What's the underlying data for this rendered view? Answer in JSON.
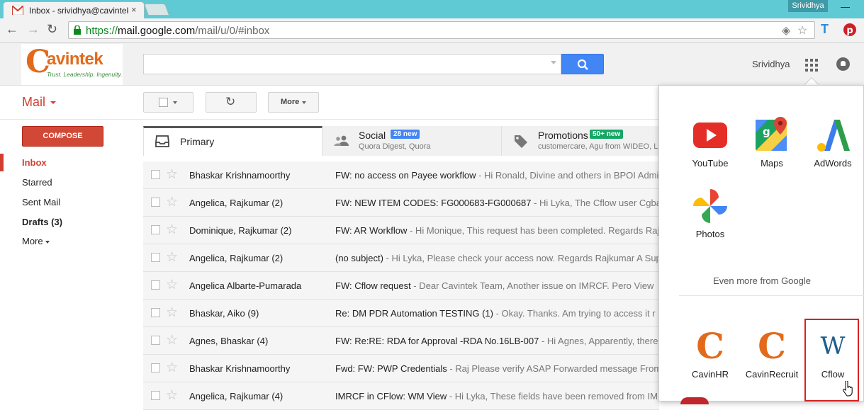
{
  "browser": {
    "tab_title": "Inbox - srividhya@cavintek",
    "tab_close": "×",
    "user_badge": "Srividhya",
    "minimize": "—",
    "url_scheme": "https://",
    "url_host": "mail.google.com",
    "url_path": "/mail/u/0/#inbox"
  },
  "header": {
    "logo_letter": "C",
    "logo_name": "avintek",
    "logo_tagline": "Trust. Leadership. Ingenuity.",
    "search_placeholder": "",
    "user_name": "Srividhya"
  },
  "toolbar": {
    "mail_label": "Mail",
    "more_label": "More"
  },
  "nav": {
    "compose_label": "COMPOSE",
    "items": [
      {
        "label": "Inbox"
      },
      {
        "label": "Starred"
      },
      {
        "label": "Sent Mail"
      },
      {
        "label": "Drafts (3)"
      },
      {
        "label": "More"
      }
    ]
  },
  "tabs": {
    "primary": {
      "label": "Primary"
    },
    "social": {
      "label": "Social",
      "badge": "28 new",
      "sub": "Quora Digest, Quora"
    },
    "promotions": {
      "label": "Promotions",
      "badge": "50+ new",
      "sub": "customercare, Agu from WIDEO, L"
    }
  },
  "emails": [
    {
      "sender": "Bhaskar Krishnamoorthy",
      "subject": "FW: no access on Payee workflow",
      "preview": " - Hi Ronald, Divine and others in BPOI Admi"
    },
    {
      "sender": "Angelica, Rajkumar (2)",
      "subject": "FW: NEW ITEM CODES: FG000683-FG000687",
      "preview": " - Hi Lyka, The Cflow user Cgba"
    },
    {
      "sender": "Dominique, Rajkumar (2)",
      "subject": "FW: AR Workflow",
      "preview": " - Hi Monique, This request has been completed. Regards Raj"
    },
    {
      "sender": "Angelica, Rajkumar (2)",
      "subject": "(no subject)",
      "preview": " - Hi Lyka, Please check your access now. Regards Rajkumar A Supp"
    },
    {
      "sender": "Angelica Albarte-Pumarada",
      "subject": "FW: Cflow request",
      "preview": " - Dear Cavintek Team, Another issue on IMRCF. Pero View"
    },
    {
      "sender": "Bhaskar, Aiko (9)",
      "subject": "Re: DM PDR Automation TESTING (1)",
      "preview": " - Okay. Thanks. Am trying to access it r"
    },
    {
      "sender": "Agnes, Bhaskar (4)",
      "subject": "FW: Re:RE: RDA for Approval -RDA No.16LB-007",
      "preview": " - Hi Agnes, Apparently, there"
    },
    {
      "sender": "Bhaskar Krishnamoorthy",
      "subject": "Fwd: FW: PWP Credentials",
      "preview": " - Raj Please verify ASAP Forwarded message From"
    },
    {
      "sender": "Angelica, Rajkumar (4)",
      "subject": "IMRCF in CFlow: WM View",
      "preview": " - Hi Lyka, These fields have been removed from IM"
    }
  ],
  "apps_panel": {
    "apps": [
      {
        "label": "YouTube",
        "icon": "youtube-icon"
      },
      {
        "label": "Maps",
        "icon": "maps-icon"
      },
      {
        "label": "AdWords",
        "icon": "adwords-icon"
      },
      {
        "label": "Photos",
        "icon": "photos-icon"
      }
    ],
    "even_more": "Even more from Google",
    "custom_apps": [
      {
        "label": "CavinHR",
        "icon": "cavinhr-icon",
        "glyph": "C"
      },
      {
        "label": "CavinRecruit",
        "icon": "cavinrecruit-icon",
        "glyph": "C"
      },
      {
        "label": "Cflow",
        "icon": "cflow-icon",
        "glyph": "W"
      }
    ]
  },
  "colors": {
    "accent_red": "#d23f31",
    "compose_red": "#d14836",
    "search_blue": "#4285f4",
    "social_badge": "#4285f4",
    "promo_badge": "#16a765",
    "cavintek_orange": "#e26a1a"
  }
}
